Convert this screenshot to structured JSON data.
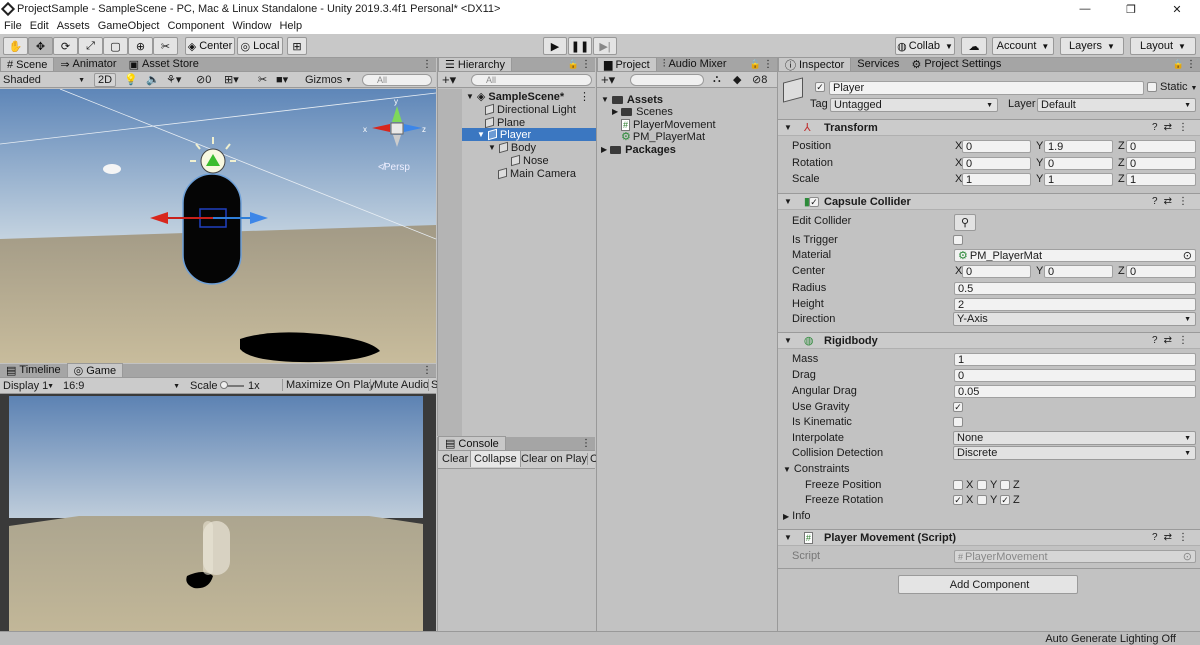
{
  "window": {
    "title": "ProjectSample - SampleScene - PC, Mac & Linux Standalone - Unity 2019.3.4f1 Personal* <DX11>",
    "minimize": "—",
    "maximize": "❐",
    "close": "✕"
  },
  "menu": [
    "File",
    "Edit",
    "Assets",
    "GameObject",
    "Component",
    "Window",
    "Help"
  ],
  "toolbar": {
    "center": "Center",
    "local": "Local",
    "collab": "Collab",
    "account": "Account",
    "layers": "Layers",
    "layout": "Layout"
  },
  "scene": {
    "tabs": [
      "Scene",
      "Animator",
      "Asset Store"
    ],
    "shading": "Shaded",
    "mode2d": "2D",
    "fx_count": "0",
    "gizmos": "Gizmos",
    "search_placeholder": "All",
    "persp": "Persp"
  },
  "game": {
    "tabs": [
      "Timeline",
      "Game"
    ],
    "display": "Display 1",
    "aspect": "16:9",
    "scale_label": "Scale",
    "scale_value": "1x",
    "maximize": "Maximize On Play",
    "mute": "Mute Audio",
    "stats": "S"
  },
  "hierarchy": {
    "tab": "Hierarchy",
    "search_placeholder": "All",
    "scene": "SampleScene*",
    "items": [
      "Directional Light",
      "Plane",
      "Player",
      "Body",
      "Nose",
      "Main Camera"
    ]
  },
  "console": {
    "tab": "Console",
    "buttons": [
      "Clear",
      "Collapse",
      "Clear on Play",
      "C"
    ]
  },
  "project": {
    "tabs": [
      "Project",
      "Audio Mixer"
    ],
    "hidden_count": "8",
    "assets": "Assets",
    "scenes": "Scenes",
    "files": [
      "PlayerMovement",
      "PM_PlayerMat"
    ],
    "packages": "Packages"
  },
  "inspector": {
    "tabs": [
      "Inspector",
      "Services",
      "Project Settings"
    ],
    "object_name": "Player",
    "static_label": "Static",
    "tag_label": "Tag",
    "tag": "Untagged",
    "layer_label": "Layer",
    "layer": "Default",
    "transform": {
      "title": "Transform",
      "position": {
        "label": "Position",
        "x": "0",
        "y": "1.9",
        "z": "0"
      },
      "rotation": {
        "label": "Rotation",
        "x": "0",
        "y": "0",
        "z": "0"
      },
      "scale": {
        "label": "Scale",
        "x": "1",
        "y": "1",
        "z": "1"
      }
    },
    "capsule": {
      "title": "Capsule Collider",
      "edit_collider": "Edit Collider",
      "is_trigger": "Is Trigger",
      "material_label": "Material",
      "material": "PM_PlayerMat",
      "center_label": "Center",
      "center": {
        "x": "0",
        "y": "0",
        "z": "0"
      },
      "radius_label": "Radius",
      "radius": "0.5",
      "height_label": "Height",
      "height": "2",
      "direction_label": "Direction",
      "direction": "Y-Axis"
    },
    "rigidbody": {
      "title": "Rigidbody",
      "mass_label": "Mass",
      "mass": "1",
      "drag_label": "Drag",
      "drag": "0",
      "angular_label": "Angular Drag",
      "angular": "0.05",
      "gravity_label": "Use Gravity",
      "kinematic_label": "Is Kinematic",
      "interpolate_label": "Interpolate",
      "interpolate": "None",
      "collision_label": "Collision Detection",
      "collision": "Discrete",
      "constraints": "Constraints",
      "freeze_pos": "Freeze Position",
      "freeze_rot": "Freeze Rotation",
      "info": "Info"
    },
    "script": {
      "title": "Player Movement (Script)",
      "label": "Script",
      "value": "PlayerMovement"
    },
    "add_component": "Add Component"
  },
  "axis": {
    "x": "X",
    "y": "Y",
    "z": "Z"
  },
  "status": "Auto Generate Lighting Off"
}
